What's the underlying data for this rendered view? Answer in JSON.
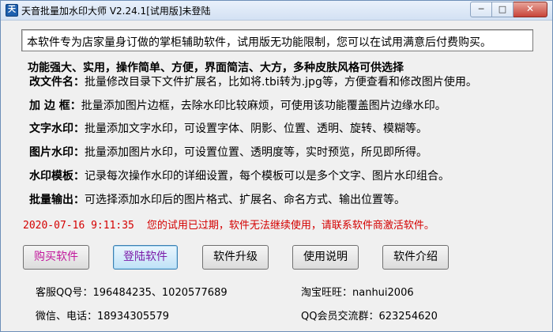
{
  "window": {
    "title": "天音批量加水印大师 V2.24.1[试用版]未登陆",
    "app_icon_glyph": "天",
    "minimize_glyph": "─",
    "maximize_glyph": "□",
    "close_glyph": "✕"
  },
  "notice": "本软件专为店家量身订做的掌柜辅助软件，试用版无功能限制，您可以在试用满意后付费购买。",
  "features": {
    "heading": "功能强大、实用，操作简单、方便，界面简洁、大方，多种皮肤风格可供选择",
    "items": [
      {
        "name": "改文件名：",
        "desc": "批量修改目录下文件扩展名，比如将.tbi转为.jpg等，方便查看和修改图片使用。"
      },
      {
        "name": "加 边 框：",
        "desc": "批量添加图片边框，去除水印比较麻烦，可使用该功能覆盖图片边缘水印。"
      },
      {
        "name": "文字水印：",
        "desc": "批量添加文字水印，可设置字体、阴影、位置、透明、旋转、模糊等。"
      },
      {
        "name": "图片水印：",
        "desc": "批量添加图片水印，可设置位置、透明度等，实时预览，所见即所得。"
      },
      {
        "name": "水印模板：",
        "desc": "记录每次操作水印的详细设置，每个模板可以是多个文字、图片水印组合。"
      },
      {
        "name": "批量输出：",
        "desc": "可选择添加水印后的图片格式、扩展名、命名方式、输出位置等。"
      }
    ]
  },
  "status": {
    "datetime": "2020-07-16 9:11:35",
    "message": "您的试用已过期，软件无法继续使用，请联系软件商激活软件。"
  },
  "buttons": {
    "buy": "购买软件",
    "login": "登陆软件",
    "upgrade": "软件升级",
    "manual": "使用说明",
    "intro": "软件介绍"
  },
  "contact": {
    "qq": "客服QQ号：196484235、1020577689",
    "wangwang": "淘宝旺旺：nanhui2006",
    "wechat": "微信、电话：18934305579",
    "qq_group": "QQ会员交流群：623254620"
  },
  "colors": {
    "status_red": "#d40000",
    "buy_text": "#c2189c",
    "login_text": "#7a1aa8"
  }
}
